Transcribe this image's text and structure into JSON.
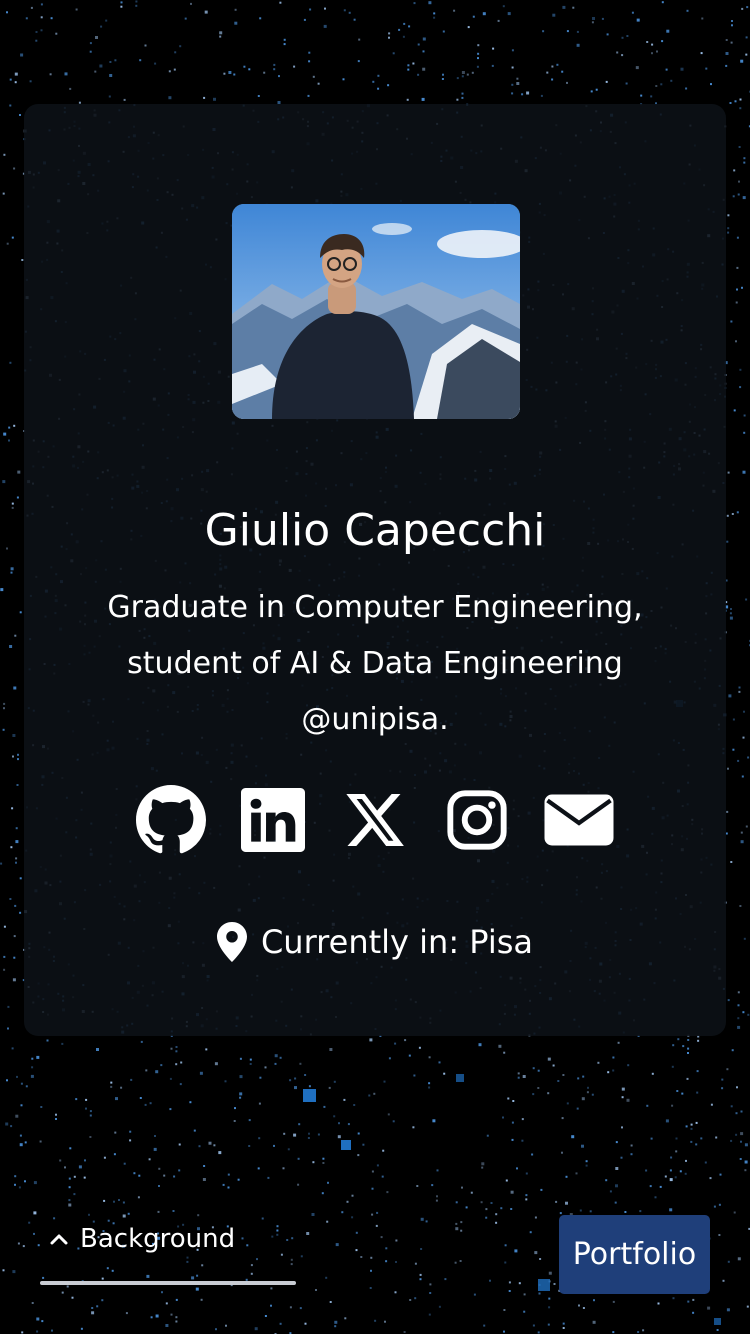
{
  "profile": {
    "name": "Giulio Capecchi",
    "bio": "Graduate in Computer Engineering, student of AI & Data Engineering @unipisa.",
    "location_label": "Currently in: Pisa"
  },
  "socials": [
    {
      "icon": "github-icon"
    },
    {
      "icon": "linkedin-icon"
    },
    {
      "icon": "x-twitter-icon"
    },
    {
      "icon": "instagram-icon"
    },
    {
      "icon": "mail-icon"
    }
  ],
  "footer": {
    "background_label": "Background",
    "portfolio_label": "Portfolio"
  },
  "colors": {
    "background": "#000000",
    "card": "#0d1117",
    "star": "#4a90d9",
    "accent_button": "#1f3f7a",
    "text": "#ffffff"
  }
}
